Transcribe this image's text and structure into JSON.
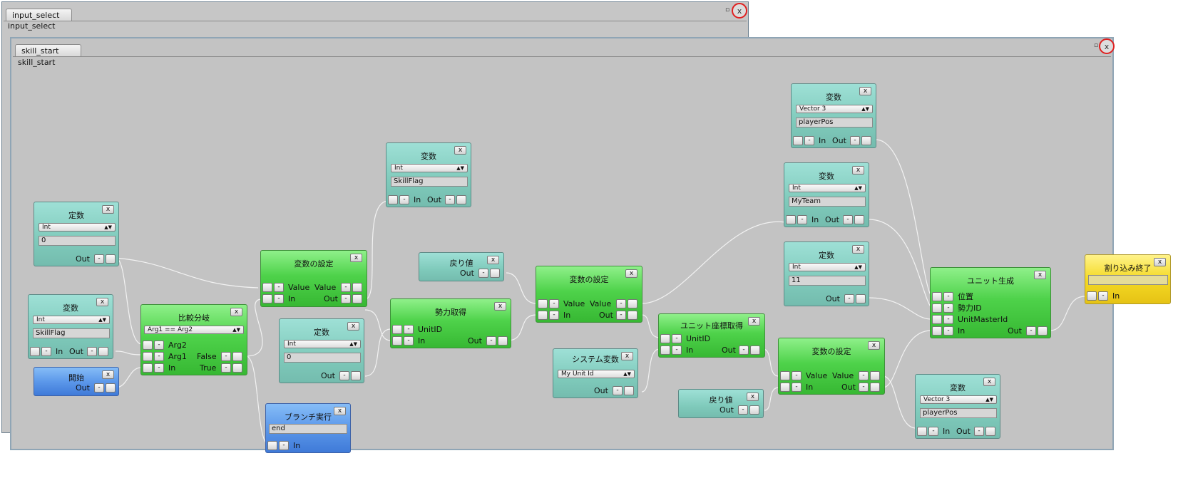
{
  "windows": [
    {
      "tab": "input_select",
      "label": "input_select",
      "close": "x",
      "min": "▫"
    },
    {
      "tab": "skill_start",
      "label": "skill_start",
      "close": "x",
      "min": "▫"
    }
  ],
  "ports": {
    "in": "In",
    "out": "Out",
    "minus": "-",
    "close": "x",
    "true": "True",
    "false": "False",
    "value": "Value",
    "arg1": "Arg1",
    "arg2": "Arg2",
    "unit_id": "UnitID",
    "pos": "位置",
    "force_id": "勢力ID",
    "unit_master_id": "UnitMasterId"
  },
  "nodes": {
    "const_int_0": {
      "title": "定数",
      "type": "Int",
      "value": "0"
    },
    "var_skillflag_left": {
      "title": "変数",
      "type": "Int",
      "value": "SkillFlag"
    },
    "start": {
      "title": "開始"
    },
    "compare_branch": {
      "title": "比較分岐",
      "expr": "Arg1 == Arg2"
    },
    "set_var_1": {
      "title": "変数の設定"
    },
    "branch_exec": {
      "title": "ブランチ実行",
      "value": "end"
    },
    "const_int_0b": {
      "title": "定数",
      "type": "Int",
      "value": "0"
    },
    "var_skillflag_top": {
      "title": "変数",
      "type": "Int",
      "value": "SkillFlag"
    },
    "return_1": {
      "title": "戻り値"
    },
    "get_force": {
      "title": "勢力取得"
    },
    "set_var_2": {
      "title": "変数の設定"
    },
    "system_var": {
      "title": "システム変数",
      "type": "My Unit Id"
    },
    "get_unit_pos": {
      "title": "ユニット座標取得"
    },
    "return_2": {
      "title": "戻り値"
    },
    "set_var_3": {
      "title": "変数の設定"
    },
    "var_playerpos_top": {
      "title": "変数",
      "type": "Vector 3",
      "value": "playerPos"
    },
    "var_myteam": {
      "title": "変数",
      "type": "Int",
      "value": "MyTeam"
    },
    "const_int_11": {
      "title": "定数",
      "type": "Int",
      "value": "11"
    },
    "unit_spawn": {
      "title": "ユニット生成"
    },
    "var_playerpos_bottom": {
      "title": "変数",
      "type": "Vector 3",
      "value": "playerPos"
    },
    "interrupt_end": {
      "title": "割り込み終了",
      "value": ""
    }
  },
  "colors": {
    "teal_node": "#86d2c4",
    "green_node": "#4ed24a",
    "blue_node": "#5c98ea",
    "yellow_node": "#f4d924",
    "canvas": "#c3c3c3",
    "close_ring": "#e02020"
  }
}
